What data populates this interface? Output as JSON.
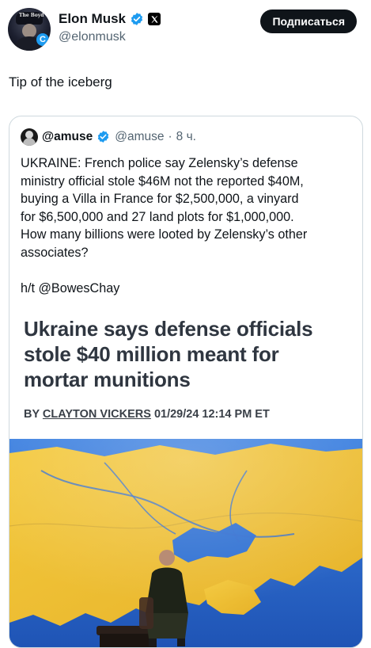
{
  "author": {
    "name": "Elon Musk",
    "handle": "@elonmusk",
    "avatar_badge": "C",
    "avatar_hat_text": "The Boyd"
  },
  "subscribe_label": "Подписаться",
  "tweet_text": "Tip of the iceberg",
  "quote": {
    "name": "@amuse",
    "handle": "@amuse",
    "dot": "·",
    "time": "8 ч.",
    "body_lines": [
      "UKRAINE: French police say Zelensky’s defense",
      "ministry official stole $46M not the reported $40M,",
      "buying a Villa in France for $2,500,000, a vinyard",
      "for $6,500,000 and 27 land plots for $1,000,000.",
      "How many billions were looted by Zelensky’s other",
      "associates?"
    ],
    "hat_tip": "h/t @BowesChay"
  },
  "article": {
    "headline_lines": [
      "Ukraine says defense officials",
      "stole $40 million meant for",
      "mortar munitions"
    ],
    "byline_prefix": "BY",
    "byline_author": "CLAYTON VICKERS",
    "byline_date": "01/29/24 12:14 PM ET"
  },
  "colors": {
    "verified_blue": "#1d9bf0",
    "text_primary": "#0f1419",
    "text_secondary": "#536471",
    "card_border": "#cfd9de",
    "map_yellow": "#f1c232",
    "map_blue": "#2d6fd2"
  },
  "icons": {
    "verified": "verified-check-icon",
    "x_logo": "x-logo-icon"
  }
}
